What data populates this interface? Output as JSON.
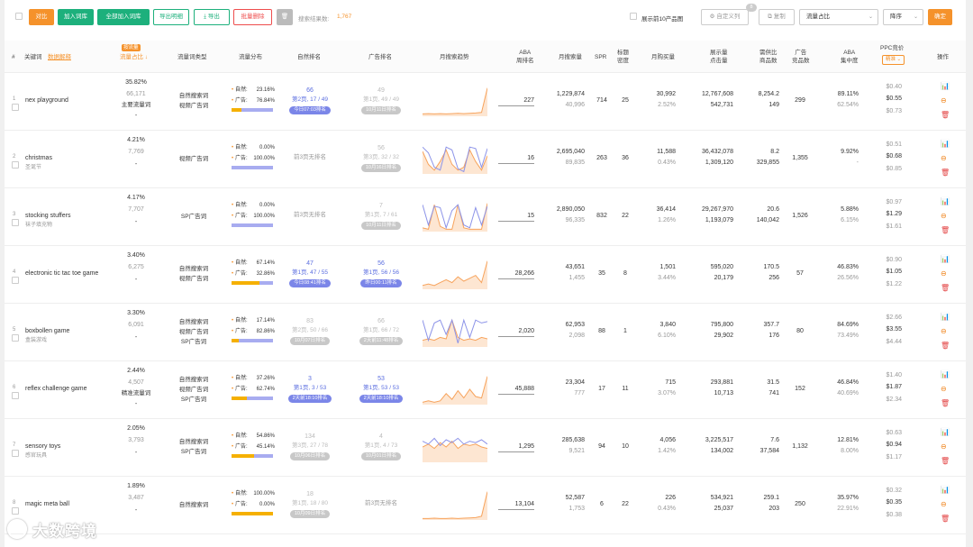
{
  "toolbar": {
    "compare": "对比",
    "add_to_library": "加入词库",
    "add_all": "全部加入词库",
    "export_detail": "导出明细",
    "export": "导出",
    "bulk_delete": "批量删除",
    "result_label": "搜索结果数:",
    "result_count": "1,767",
    "show_top10": "展示前10产品图",
    "custom_columns": "自定义列",
    "custom_badge": "8",
    "copy": "复制",
    "sort_field": "流量占比",
    "sort_order": "降序",
    "confirm": "确定"
  },
  "header": {
    "num": "#",
    "keyword": "关键词",
    "data_source": "数据解释",
    "share_tag": "按流量",
    "traffic_share": "流量占比",
    "word_type": "流量词类型",
    "traffic_dist": "流量分布",
    "natural_rank": "自然排名",
    "ad_rank": "广告排名",
    "monthly_trend": "月搜索趋势",
    "aba_rank_1": "ABA",
    "aba_rank_2": "周排名",
    "monthly_search": "月搜索量",
    "spr": "SPR",
    "title_density_1": "标题",
    "title_density_2": "密度",
    "monthly_purchase": "月购买量",
    "impressions_1": "展示量",
    "impressions_2": "点击量",
    "supply_demand_1": "需供比",
    "supply_demand_2": "商品数",
    "ad_products_1": "广告",
    "ad_products_2": "竞品数",
    "aba_conc_1": "ABA",
    "aba_conc_2": "集中度",
    "ppc_1": "PPC竞价",
    "ppc_select": "精准",
    "actions": "操作"
  },
  "rows": [
    {
      "idx": "1",
      "kw": "nex playground",
      "kw_cn": "",
      "share": "35.82%",
      "share_num": "66,171",
      "share_tag": "主要流量词",
      "share_dash": "-",
      "types": [
        "自然搜索词",
        "视频广告词"
      ],
      "nat_label": "自然:",
      "nat_pct": "23.16%",
      "ad_label": "广告:",
      "ad_pct": "76.84%",
      "natural": 0.2316,
      "nr_top": "66",
      "nr_mid": "第2页, 17 / 49",
      "nr_pill": "今日07:03排名",
      "nr_active": true,
      "ar_top": "49",
      "ar_mid": "第1页, 49 / 49",
      "ar_pill": "10月11日排名",
      "ar_active": false,
      "aba": "227",
      "ms": "1,229,874",
      "ms2": "40,996",
      "spr": "714",
      "td": "25",
      "mp": "30,992",
      "mp2": "2.52%",
      "imp": "12,767,608",
      "clk": "542,731",
      "sd": "8,254.2",
      "sd2": "149",
      "adp": "299",
      "conc": "89.11%",
      "conc2": "62.54%",
      "ppc_lo": "$0.40",
      "ppc": "$0.55",
      "ppc_hi": "$0.73",
      "trend_a": [
        0.05,
        0.06,
        0.05,
        0.06,
        0.05,
        0.06,
        0.07,
        0.06,
        0.07,
        0.08,
        0.1,
        0.95
      ],
      "trend_b": []
    },
    {
      "idx": "2",
      "kw": "christmas",
      "kw_cn": "圣诞节",
      "share": "4.21%",
      "share_num": "7,769",
      "share_tag": "",
      "share_dash": "-",
      "types": [
        "视频广告词"
      ],
      "nat_label": "自然:",
      "nat_pct": "0.00%",
      "ad_label": "广告:",
      "ad_pct": "100.00%",
      "natural": 0,
      "nr_top": "",
      "nr_mid": "前3页无排名",
      "nr_pill": "",
      "nr_active": false,
      "ar_top": "56",
      "ar_mid": "第3页, 32 / 32",
      "ar_pill": "10月16日排名",
      "ar_active": false,
      "aba": "16",
      "ms": "2,695,040",
      "ms2": "89,835",
      "spr": "263",
      "td": "36",
      "mp": "11,588",
      "mp2": "0.43%",
      "imp": "36,432,078",
      "clk": "1,309,120",
      "sd": "8.2",
      "sd2": "329,855",
      "adp": "1,355",
      "conc": "9.92%",
      "conc2": "-",
      "ppc_lo": "$0.51",
      "ppc": "$0.68",
      "ppc_hi": "$0.85",
      "trend_a": [
        0.75,
        0.3,
        0.1,
        0.4,
        0.8,
        0.3,
        0.1,
        0.2,
        0.8,
        0.4,
        0.1,
        0.6
      ],
      "trend_b": [
        0.9,
        0.7,
        0.2,
        0.1,
        0.9,
        0.8,
        0.15,
        0.05,
        0.9,
        0.85,
        0.2,
        0.85
      ]
    },
    {
      "idx": "3",
      "kw": "stocking stuffers",
      "kw_cn": "袜子填充物",
      "share": "4.17%",
      "share_num": "7,707",
      "share_tag": "",
      "share_dash": "-",
      "types": [
        "SP广告词"
      ],
      "nat_label": "自然:",
      "nat_pct": "0.00%",
      "ad_label": "广告:",
      "ad_pct": "100.00%",
      "natural": 0,
      "nr_top": "",
      "nr_mid": "前3页无排名",
      "nr_pill": "",
      "nr_active": false,
      "ar_top": "7",
      "ar_mid": "第1页, 7 / 61",
      "ar_pill": "10月11日排名",
      "ar_active": false,
      "aba": "15",
      "ms": "2,890,050",
      "ms2": "96,335",
      "spr": "832",
      "td": "22",
      "mp": "36,414",
      "mp2": "1.26%",
      "imp": "29,267,970",
      "clk": "1,193,079",
      "sd": "20.6",
      "sd2": "140,042",
      "adp": "1,526",
      "conc": "5.88%",
      "conc2": "6.15%",
      "ppc_lo": "$0.97",
      "ppc": "$1.29",
      "ppc_hi": "$1.61",
      "trend_a": [
        0.1,
        0.05,
        0.9,
        0.15,
        0.05,
        0.05,
        0.9,
        0.1,
        0.05,
        0.05,
        0.05,
        0.95
      ],
      "trend_b": [
        0.9,
        0.2,
        0.85,
        0.8,
        0.1,
        0.7,
        0.9,
        0.2,
        0.1,
        0.8,
        0.2,
        0.85
      ]
    },
    {
      "idx": "4",
      "kw": "electronic tic tac toe game",
      "kw_cn": "",
      "share": "3.40%",
      "share_num": "6,275",
      "share_tag": "",
      "share_dash": "-",
      "types": [
        "自然搜索词",
        "视频广告词"
      ],
      "nat_label": "自然:",
      "nat_pct": "67.14%",
      "ad_label": "广告:",
      "ad_pct": "32.86%",
      "natural": 0.6714,
      "nr_top": "47",
      "nr_mid": "第1页, 47 / 55",
      "nr_pill": "今日08:41排名",
      "nr_active": true,
      "ar_top": "56",
      "ar_mid": "第1页, 56 / 56",
      "ar_pill": "昨日00:11排名",
      "ar_active": true,
      "aba": "28,266",
      "ms": "43,651",
      "ms2": "1,455",
      "spr": "35",
      "td": "8",
      "mp": "1,501",
      "mp2": "3.44%",
      "imp": "595,020",
      "clk": "20,179",
      "sd": "170.5",
      "sd2": "256",
      "adp": "57",
      "conc": "46.83%",
      "conc2": "26.56%",
      "ppc_lo": "$0.90",
      "ppc": "$1.05",
      "ppc_hi": "$1.22",
      "trend_a": [
        0.1,
        0.15,
        0.1,
        0.2,
        0.3,
        0.2,
        0.4,
        0.25,
        0.35,
        0.45,
        0.2,
        0.95
      ],
      "trend_b": []
    },
    {
      "idx": "5",
      "kw": "boxbollen game",
      "kw_cn": "盒装游戏",
      "share": "3.30%",
      "share_num": "6,091",
      "share_tag": "",
      "share_dash": "-",
      "types": [
        "自然搜索词",
        "视频广告词",
        "SP广告词"
      ],
      "nat_label": "自然:",
      "nat_pct": "17.14%",
      "ad_label": "广告:",
      "ad_pct": "82.86%",
      "natural": 0.1714,
      "nr_top": "83",
      "nr_mid": "第2页, 50 / 66",
      "nr_pill": "10月07日排名",
      "nr_active": false,
      "ar_top": "66",
      "ar_mid": "第1页, 66 / 72",
      "ar_pill": "2天前11:48排名",
      "ar_active": false,
      "aba": "2,020",
      "ms": "62,953",
      "ms2": "2,098",
      "spr": "88",
      "td": "1",
      "mp": "3,840",
      "mp2": "6.10%",
      "imp": "795,800",
      "clk": "29,902",
      "sd": "357.7",
      "sd2": "176",
      "adp": "80",
      "conc": "84.69%",
      "conc2": "73.49%",
      "ppc_lo": "$2.66",
      "ppc": "$3.55",
      "ppc_hi": "$4.44",
      "trend_a": [
        0.2,
        0.25,
        0.2,
        0.3,
        0.25,
        0.9,
        0.3,
        0.2,
        0.25,
        0.2,
        0.3,
        0.25
      ],
      "trend_b": [
        0.9,
        0.2,
        0.8,
        0.9,
        0.4,
        0.9,
        0.1,
        0.9,
        0.3,
        0.9,
        0.8,
        0.85
      ]
    },
    {
      "idx": "6",
      "kw": "reflex challenge game",
      "kw_cn": "",
      "share": "2.44%",
      "share_num": "4,507",
      "share_tag": "精准流量词",
      "share_dash": "-",
      "types": [
        "自然搜索词",
        "视频广告词",
        "SP广告词"
      ],
      "nat_label": "自然:",
      "nat_pct": "37.26%",
      "ad_label": "广告:",
      "ad_pct": "62.74%",
      "natural": 0.3726,
      "nr_top": "3",
      "nr_mid": "第1页, 3 / 53",
      "nr_pill": "2天前18:10排名",
      "nr_active": true,
      "ar_top": "53",
      "ar_mid": "第1页, 53 / 53",
      "ar_pill": "2天前18:10排名",
      "ar_active": true,
      "aba": "45,888",
      "ms": "23,304",
      "ms2": "777",
      "spr": "17",
      "td": "11",
      "mp": "715",
      "mp2": "3.07%",
      "imp": "293,881",
      "clk": "10,713",
      "sd": "31.5",
      "sd2": "741",
      "adp": "152",
      "conc": "46.84%",
      "conc2": "40.69%",
      "ppc_lo": "$1.40",
      "ppc": "$1.87",
      "ppc_hi": "$2.34",
      "trend_a": [
        0.05,
        0.1,
        0.05,
        0.1,
        0.35,
        0.15,
        0.45,
        0.2,
        0.5,
        0.25,
        0.2,
        0.95
      ],
      "trend_b": []
    },
    {
      "idx": "7",
      "kw": "sensory toys",
      "kw_cn": "感官玩具",
      "share": "2.05%",
      "share_num": "3,793",
      "share_tag": "",
      "share_dash": "-",
      "types": [
        "自然搜索词",
        "SP广告词"
      ],
      "nat_label": "自然:",
      "nat_pct": "54.86%",
      "ad_label": "广告:",
      "ad_pct": "45.14%",
      "natural": 0.5486,
      "nr_top": "134",
      "nr_mid": "第3页, 27 / 78",
      "nr_pill": "10月06日排名",
      "nr_active": false,
      "ar_top": "4",
      "ar_mid": "第1页, 4 / 73",
      "ar_pill": "10月01日排名",
      "ar_active": false,
      "aba": "1,295",
      "ms": "285,638",
      "ms2": "9,521",
      "spr": "94",
      "td": "10",
      "mp": "4,056",
      "mp2": "1.42%",
      "imp": "3,225,517",
      "clk": "134,002",
      "sd": "7.6",
      "sd2": "37,584",
      "adp": "1,132",
      "conc": "12.81%",
      "conc2": "8.00%",
      "ppc_lo": "$0.63",
      "ppc": "$0.94",
      "ppc_hi": "$1.17",
      "trend_a": [
        0.5,
        0.6,
        0.45,
        0.65,
        0.5,
        0.7,
        0.45,
        0.6,
        0.55,
        0.6,
        0.5,
        0.45
      ],
      "trend_b": [
        0.7,
        0.6,
        0.8,
        0.55,
        0.75,
        0.65,
        0.8,
        0.6,
        0.7,
        0.65,
        0.75,
        0.6
      ]
    },
    {
      "idx": "8",
      "kw": "magic meta ball",
      "kw_cn": "",
      "share": "1.89%",
      "share_num": "3,487",
      "share_tag": "",
      "share_dash": "-",
      "types": [
        "自然搜索词"
      ],
      "nat_label": "自然:",
      "nat_pct": "100.00%",
      "ad_label": "广告:",
      "ad_pct": "0.00%",
      "natural": 1,
      "nr_top": "18",
      "nr_mid": "第1页, 18 / 80",
      "nr_pill": "10月09日排名",
      "nr_active": false,
      "ar_top": "",
      "ar_mid": "前3页无排名",
      "ar_pill": "",
      "ar_active": false,
      "aba": "13,104",
      "ms": "52,587",
      "ms2": "1,753",
      "spr": "6",
      "td": "22",
      "mp": "226",
      "mp2": "0.43%",
      "imp": "534,921",
      "clk": "25,037",
      "sd": "259.1",
      "sd2": "203",
      "adp": "250",
      "conc": "35.97%",
      "conc2": "22.91%",
      "ppc_lo": "$0.32",
      "ppc": "$0.35",
      "ppc_hi": "$0.38",
      "trend_a": [
        0.02,
        0.02,
        0.03,
        0.02,
        0.02,
        0.03,
        0.02,
        0.03,
        0.04,
        0.05,
        0.1,
        0.95
      ],
      "trend_b": []
    }
  ],
  "watermark": "大数跨境",
  "colors": {
    "orange": "#f5922b",
    "green": "#1db07c",
    "red": "#ee4d4d",
    "blue": "#5b6ee0",
    "natural_bar": "#f5b000",
    "ad_bar": "#a8acf0",
    "trend_orange": "#f7a35c",
    "trend_blue": "#8c93e8"
  }
}
